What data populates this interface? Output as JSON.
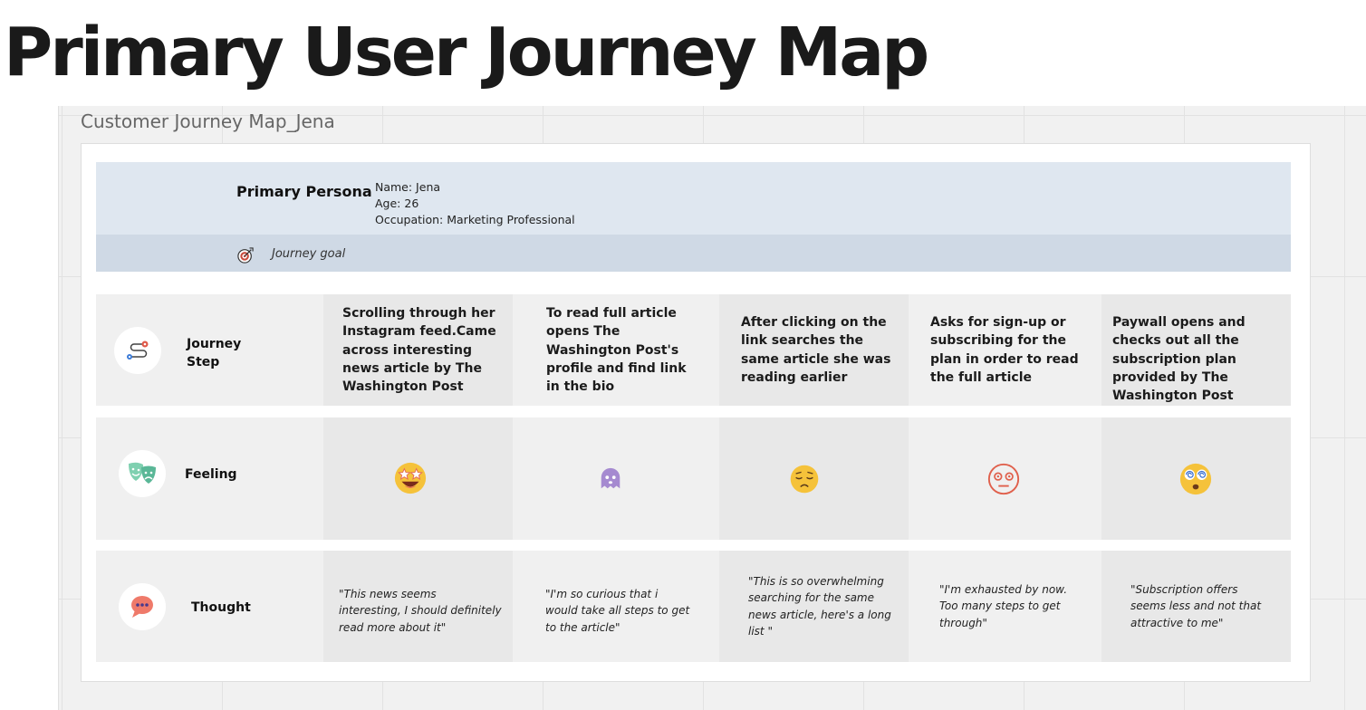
{
  "page_title": "Primary User Journey Map",
  "frame_label": "Customer Journey Map_Jena",
  "persona": {
    "title": "Primary Persona",
    "name": "Name: Jena",
    "age": "Age: 26",
    "occupation": "Occupation: Marketing Professional"
  },
  "journey_goal": "Journey goal",
  "rows": {
    "journey_step": "Journey Step",
    "feeling": "Feeling",
    "thought": "Thought"
  },
  "stages": [
    {
      "step": "Scrolling through her Instagram feed.Came across interesting news article by The Washington Post",
      "feeling_icon": "star-struck-emoji",
      "thought": "\"This news seems interesting, I should definitely read more about it\""
    },
    {
      "step": "To read full article opens The Washington Post's profile and find link in the bio",
      "feeling_icon": "ghost-emoji",
      "thought": "\"I'm so curious that i would take all steps to get to the article\""
    },
    {
      "step": "After clicking on the link searches the same article she was reading earlier",
      "feeling_icon": "weary-emoji",
      "thought": "\"This is so overwhelming searching for the same news article, here's a long list \""
    },
    {
      "step": "Asks for sign-up or subscribing for the plan in order to read the full article",
      "feeling_icon": "flushed-outline-emoji",
      "thought": "\"I'm exhausted by now. Too many steps to get through\""
    },
    {
      "step": "Paywall opens and checks out all the subscription plan provided by The Washington Post",
      "feeling_icon": "dizzy-face-emoji",
      "thought": "\"Subscription offers seems less and not that attractive to me\""
    }
  ]
}
